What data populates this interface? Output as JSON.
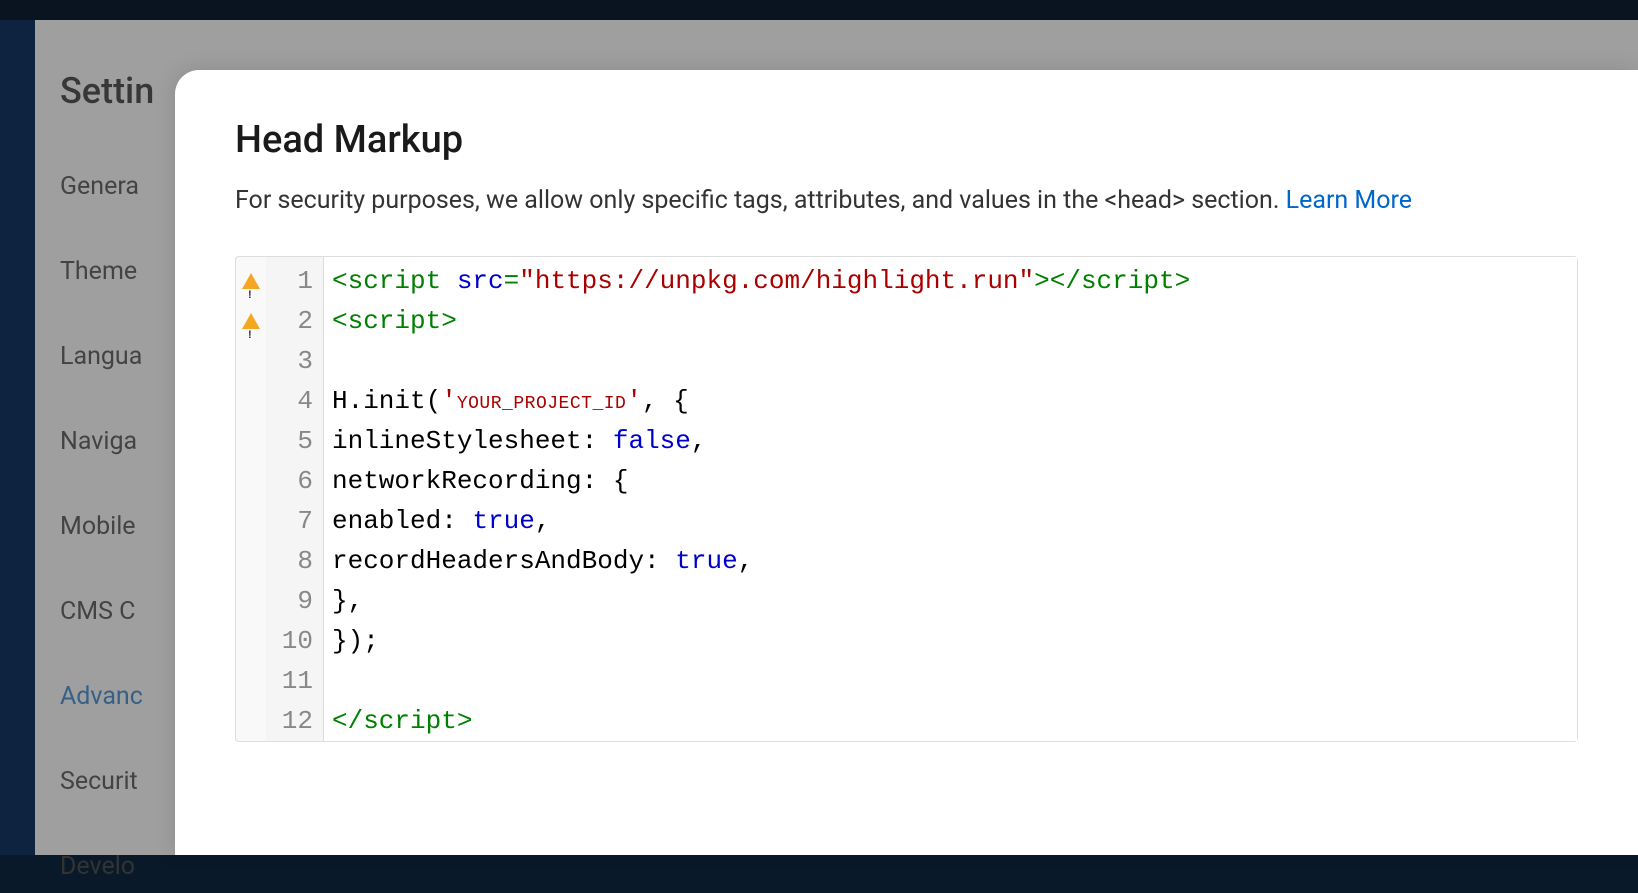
{
  "sidebar": {
    "title": "Settin",
    "items": [
      {
        "label": "Genera"
      },
      {
        "label": "Theme"
      },
      {
        "label": "Langua"
      },
      {
        "label": "Naviga"
      },
      {
        "label": "Mobile"
      },
      {
        "label": "CMS C"
      },
      {
        "label": "Advanc",
        "active": true
      },
      {
        "label": "Securit"
      },
      {
        "label": "Develo"
      }
    ]
  },
  "modal": {
    "title": "Head Markup",
    "description": "For security purposes, we allow only specific tags, attributes, and values in the <head> section. ",
    "link_text": "Learn More"
  },
  "code": {
    "lines": [
      {
        "n": "1",
        "warning": true,
        "tokens": [
          {
            "t": "<script ",
            "c": "tok-tag"
          },
          {
            "t": "src",
            "c": "tok-attr"
          },
          {
            "t": "=",
            "c": "tok-tag"
          },
          {
            "t": "\"https://unpkg.com/highlight.run\"",
            "c": "tok-str"
          },
          {
            "t": "></script>",
            "c": "tok-tag"
          }
        ]
      },
      {
        "n": "2",
        "warning": true,
        "tokens": [
          {
            "t": "<script>",
            "c": "tok-tag"
          }
        ]
      },
      {
        "n": "3",
        "warning": false,
        "tokens": []
      },
      {
        "n": "4",
        "warning": false,
        "tokens": [
          {
            "t": "H.init(",
            "c": ""
          },
          {
            "t": "'",
            "c": "tok-str"
          },
          {
            "t": "YOUR_PROJECT_ID",
            "c": "tok-var"
          },
          {
            "t": "'",
            "c": "tok-str"
          },
          {
            "t": ", {",
            "c": ""
          }
        ]
      },
      {
        "n": "5",
        "warning": false,
        "tokens": [
          {
            "t": "inlineStylesheet: ",
            "c": ""
          },
          {
            "t": "false",
            "c": "tok-keyword"
          },
          {
            "t": ",",
            "c": ""
          }
        ]
      },
      {
        "n": "6",
        "warning": false,
        "tokens": [
          {
            "t": "networkRecording: {",
            "c": ""
          }
        ]
      },
      {
        "n": "7",
        "warning": false,
        "tokens": [
          {
            "t": "enabled: ",
            "c": ""
          },
          {
            "t": "true",
            "c": "tok-keyword"
          },
          {
            "t": ",",
            "c": ""
          }
        ]
      },
      {
        "n": "8",
        "warning": false,
        "tokens": [
          {
            "t": "recordHeadersAndBody: ",
            "c": ""
          },
          {
            "t": "true",
            "c": "tok-keyword"
          },
          {
            "t": ",",
            "c": ""
          }
        ]
      },
      {
        "n": "9",
        "warning": false,
        "tokens": [
          {
            "t": "},",
            "c": ""
          }
        ]
      },
      {
        "n": "10",
        "warning": false,
        "tokens": [
          {
            "t": "});",
            "c": ""
          }
        ]
      },
      {
        "n": "11",
        "warning": false,
        "tokens": []
      },
      {
        "n": "12",
        "warning": false,
        "tokens": [
          {
            "t": "</script>",
            "c": "tok-tag"
          }
        ]
      }
    ]
  }
}
